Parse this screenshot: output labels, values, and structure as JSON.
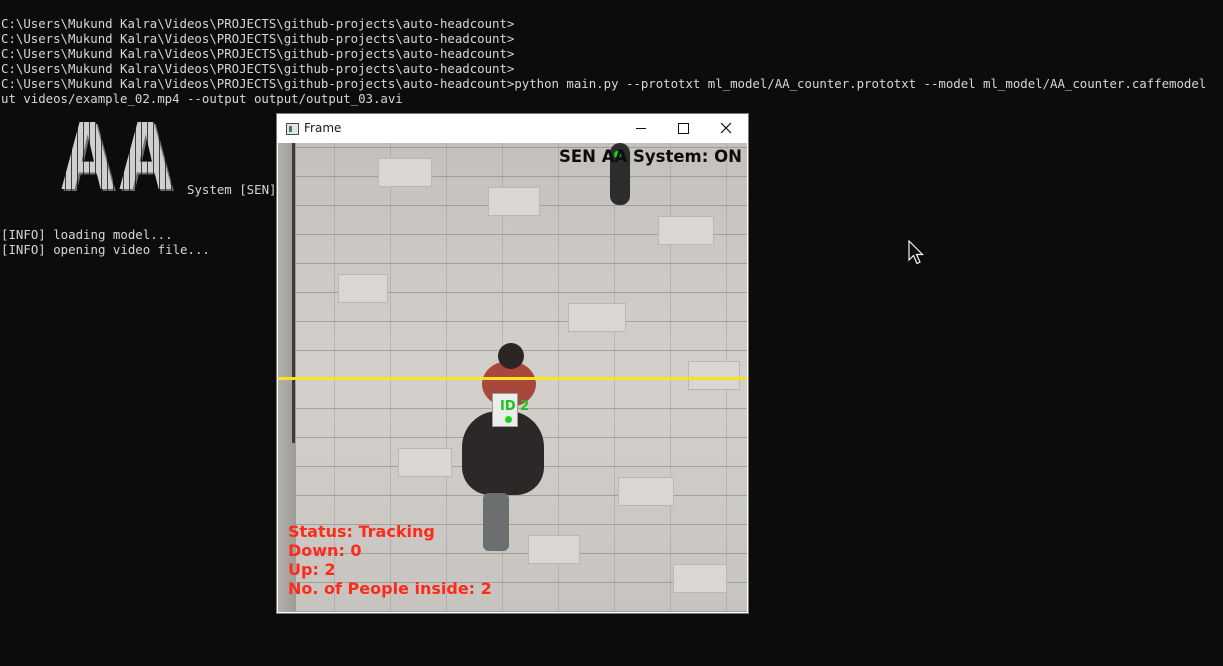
{
  "terminal": {
    "prompt_lines": [
      "C:\\Users\\Mukund Kalra\\Videos\\PROJECTS\\github-projects\\auto-headcount>",
      "C:\\Users\\Mukund Kalra\\Videos\\PROJECTS\\github-projects\\auto-headcount>",
      "C:\\Users\\Mukund Kalra\\Videos\\PROJECTS\\github-projects\\auto-headcount>",
      "C:\\Users\\Mukund Kalra\\Videos\\PROJECTS\\github-projects\\auto-headcount>",
      "C:\\Users\\Mukund Kalra\\Videos\\PROJECTS\\github-projects\\auto-headcount>python main.py --prototxt ml_model/AA_counter.prototxt --model ml_model/AA_counter.caffemodel",
      "ut videos/example_02.mp4 --output output/output_03.avi"
    ],
    "banner_letters": [
      "A",
      "A"
    ],
    "banner_subtitle": "System [SEN]",
    "info_lines": [
      "[INFO] loading model...",
      "[INFO] opening video file..."
    ]
  },
  "frame_window": {
    "title": "Frame",
    "buttons": {
      "minimize": "minimize-icon",
      "maximize": "maximize-icon",
      "close": "close-icon"
    },
    "video": {
      "top_overlay": "SEN AA System: ON",
      "track_label": "ID 2",
      "status": "Status: Tracking",
      "down": "Down: 0",
      "up": "Up: 2",
      "inside": "No. of People inside: 2",
      "colors": {
        "status_text": "#ff2a1a",
        "count_line": "#ffe21a",
        "centroid": "#1ed21e"
      }
    }
  }
}
